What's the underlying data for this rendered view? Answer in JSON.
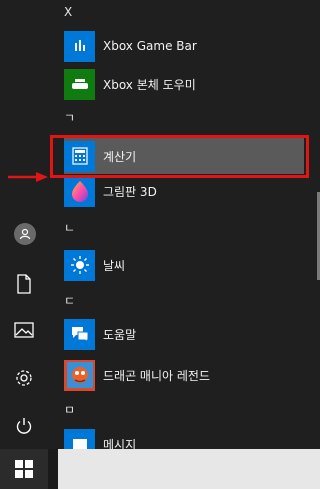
{
  "sections": [
    {
      "letter": "X"
    },
    {
      "letter": "ㄱ"
    },
    {
      "letter": "ㄴ"
    },
    {
      "letter": "ㄷ"
    },
    {
      "letter": "ㅁ"
    }
  ],
  "apps": {
    "xbox_game_bar": "Xbox Game Bar",
    "xbox_console": "Xbox 본체 도우미",
    "calculator": "계산기",
    "paint3d": "그림판 3D",
    "weather": "날씨",
    "help": "도움말",
    "dragon_mania": "드래곤 매니아 레전드",
    "messages": "메시지"
  },
  "colors": {
    "tile_blue": "#0078d7",
    "xbox_green": "#107c10",
    "highlight": "#e11515",
    "selected_bg": "#5a5a5a"
  },
  "icons": {
    "rail": [
      "user-icon",
      "document-icon",
      "pictures-icon",
      "settings-icon",
      "power-icon"
    ],
    "start": "windows-logo-icon"
  }
}
